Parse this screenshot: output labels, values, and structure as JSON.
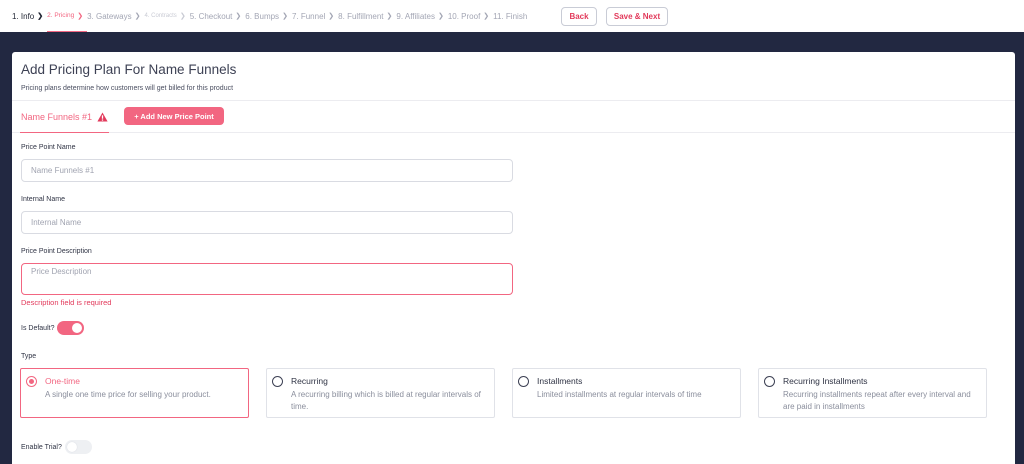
{
  "steps": [
    {
      "label": "1. Info",
      "state": "done"
    },
    {
      "label": "2. Pricing",
      "state": "active"
    },
    {
      "label": "3. Gateways",
      "state": "normal"
    },
    {
      "label": "4. Contracts",
      "state": "disabled"
    },
    {
      "label": "5. Checkout",
      "state": "normal"
    },
    {
      "label": "6. Bumps",
      "state": "normal"
    },
    {
      "label": "7. Funnel",
      "state": "normal"
    },
    {
      "label": "8. Fulfillment",
      "state": "normal"
    },
    {
      "label": "9. Affiliates",
      "state": "normal"
    },
    {
      "label": "10. Proof",
      "state": "normal"
    },
    {
      "label": "11. Finish",
      "state": "normal"
    }
  ],
  "header_buttons": {
    "back": "Back",
    "save_next": "Save & Next"
  },
  "card": {
    "title": "Add Pricing Plan For Name Funnels",
    "subtitle": "Pricing plans determine how customers will get billed for this product"
  },
  "tabs": {
    "active": "Name Funnels #1",
    "add_button": "+ Add New Price Point"
  },
  "form": {
    "price_point_name": {
      "label": "Price Point Name",
      "placeholder": "Name Funnels #1"
    },
    "internal_name": {
      "label": "Internal Name",
      "placeholder": "Internal Name"
    },
    "description": {
      "label": "Price Point Description",
      "placeholder": "Price Description",
      "error": "Description field is required"
    },
    "is_default": {
      "label": "Is Default?",
      "value": true
    },
    "type_label": "Type",
    "types": [
      {
        "title": "One-time",
        "desc": "A single one time price for selling your product.",
        "selected": true
      },
      {
        "title": "Recurring",
        "desc": "A recurring billing which is billed at regular intervals of time.",
        "selected": false
      },
      {
        "title": "Installments",
        "desc": "Limited installments at regular intervals of time",
        "selected": false
      },
      {
        "title": "Recurring Installments",
        "desc": "Recurring installments repeat after every interval and are paid in installments",
        "selected": false
      }
    ],
    "enable_trial": {
      "label": "Enable Trial?",
      "value": false
    }
  },
  "colors": {
    "accent": "#f26681",
    "frame": "#222841",
    "error": "#e23a5b"
  },
  "icons": {
    "warning": "warning-icon",
    "step_separator": "chevron-right-icon"
  }
}
